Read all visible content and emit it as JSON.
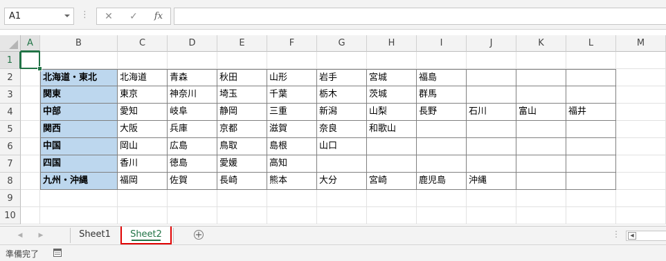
{
  "formula_bar": {
    "name_box": "A1",
    "cancel_glyph": "✕",
    "enter_glyph": "✓",
    "function_glyph": "fx",
    "formula_value": ""
  },
  "columns": [
    "A",
    "B",
    "C",
    "D",
    "E",
    "F",
    "G",
    "H",
    "I",
    "J",
    "K",
    "L",
    "M"
  ],
  "rows": [
    "1",
    "2",
    "3",
    "4",
    "5",
    "6",
    "7",
    "8",
    "9",
    "10"
  ],
  "active_cell": "A1",
  "table": [
    {
      "region": "北海道・東北",
      "prefectures": [
        "北海道",
        "青森",
        "秋田",
        "山形",
        "岩手",
        "宮城",
        "福島",
        "",
        "",
        ""
      ]
    },
    {
      "region": "関東",
      "prefectures": [
        "東京",
        "神奈川",
        "埼玉",
        "千葉",
        "栃木",
        "茨城",
        "群馬",
        "",
        "",
        ""
      ]
    },
    {
      "region": "中部",
      "prefectures": [
        "愛知",
        "岐阜",
        "静岡",
        "三重",
        "新潟",
        "山梨",
        "長野",
        "石川",
        "富山",
        "福井"
      ]
    },
    {
      "region": "関西",
      "prefectures": [
        "大阪",
        "兵庫",
        "京都",
        "滋賀",
        "奈良",
        "和歌山",
        "",
        "",
        "",
        ""
      ]
    },
    {
      "region": "中国",
      "prefectures": [
        "岡山",
        "広島",
        "鳥取",
        "島根",
        "山口",
        "",
        "",
        "",
        "",
        ""
      ]
    },
    {
      "region": "四国",
      "prefectures": [
        "香川",
        "徳島",
        "愛媛",
        "高知",
        "",
        "",
        "",
        "",
        "",
        ""
      ]
    },
    {
      "region": "九州・沖縄",
      "prefectures": [
        "福岡",
        "佐賀",
        "長崎",
        "熊本",
        "大分",
        "宮崎",
        "鹿児島",
        "沖縄",
        "",
        ""
      ]
    }
  ],
  "sheet_tabs": [
    {
      "label": "Sheet1",
      "active": false
    },
    {
      "label": "Sheet2",
      "active": true
    }
  ],
  "status_bar": {
    "text": "準備完了"
  },
  "colors": {
    "accent": "#217346",
    "region_fill": "#bdd7ee",
    "tab_highlight_border": "#e00000"
  }
}
